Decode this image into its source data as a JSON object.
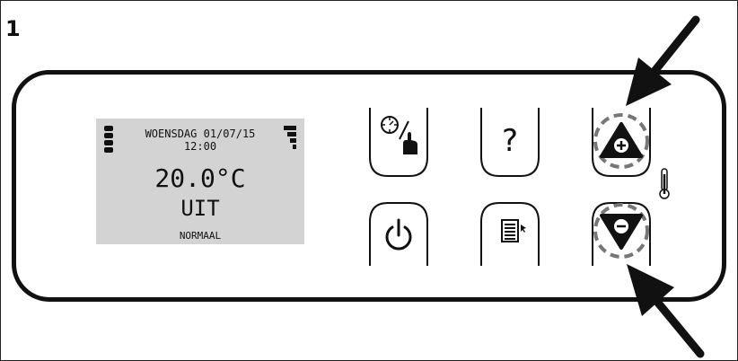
{
  "figure": {
    "number": "1"
  },
  "display": {
    "date": "WOENSDAG 01/07/15",
    "time": "12:00",
    "temperature": "20.0°C",
    "mode": "UIT",
    "profile": "NORMAAL",
    "background": "#d3d3d3"
  },
  "buttons": [
    {
      "id": "schedule",
      "icon": "clock-hand-icon"
    },
    {
      "id": "help",
      "icon": "question-mark-icon",
      "label": "?"
    },
    {
      "id": "increase",
      "icon": "plus-triangle-icon"
    },
    {
      "id": "power",
      "icon": "power-icon"
    },
    {
      "id": "menu",
      "icon": "menu-list-icon"
    },
    {
      "id": "decrease",
      "icon": "minus-triangle-icon"
    }
  ],
  "indicators": {
    "thermometer": "thermometer-icon",
    "callout_arrows": [
      "arrow-to-increase",
      "arrow-to-decrease"
    ]
  }
}
